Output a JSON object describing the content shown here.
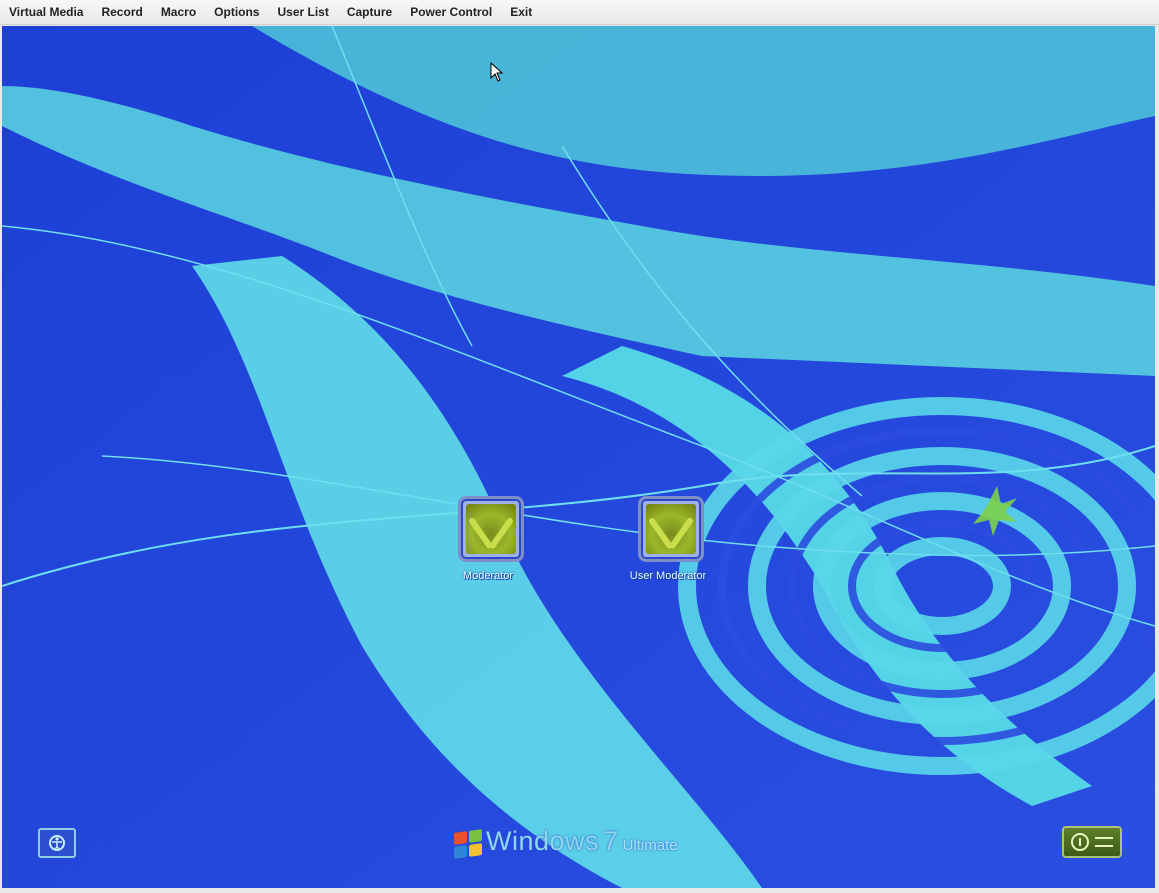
{
  "menu": {
    "items": [
      "Virtual Media",
      "Record",
      "Macro",
      "Options",
      "User List",
      "Capture",
      "Power Control",
      "Exit"
    ]
  },
  "login_screen": {
    "users": [
      {
        "name": "Moderator"
      },
      {
        "name": "User Moderator"
      }
    ],
    "branding": {
      "product": "Windows",
      "version": "7",
      "edition": "Ultimate"
    },
    "ease_of_access_icon": "ease-of-access-icon",
    "power_icon": "power-icon",
    "shutdown_options_icon": "arrow-icon"
  },
  "colors": {
    "background_dark": "#2344d6",
    "background_light": "#62d6e6",
    "menu_bg": "#efefef",
    "power_green": "#4f6d1f"
  }
}
